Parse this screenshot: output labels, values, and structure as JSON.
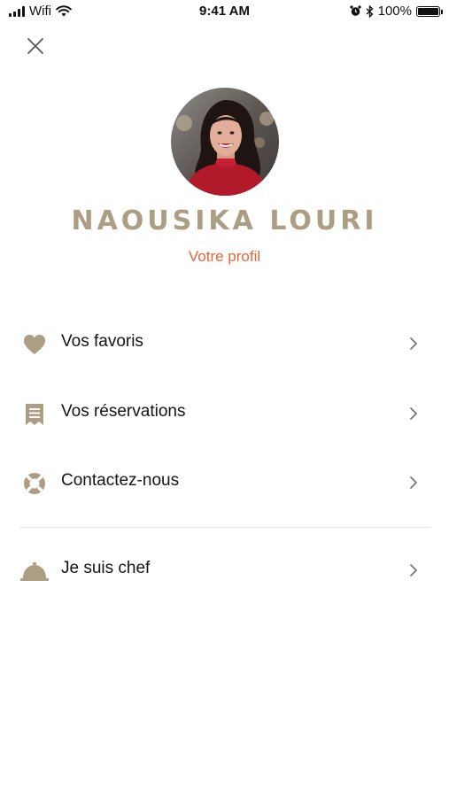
{
  "status_bar": {
    "carrier": "Wifi",
    "time": "9:41 AM",
    "battery_percent": "100%"
  },
  "profile": {
    "name": "NAOUSIKA LOURI",
    "profile_link": "Votre profil"
  },
  "menu": {
    "items": [
      {
        "label": "Vos favoris",
        "icon": "heart-icon"
      },
      {
        "label": "Vos réservations",
        "icon": "receipt-icon"
      },
      {
        "label": "Contactez-nous",
        "icon": "lifebuoy-icon"
      },
      {
        "label": "Je suis chef",
        "icon": "service-bell-icon"
      }
    ]
  },
  "colors": {
    "accent_gold": "#ab9e82",
    "link_orange": "#e5673a",
    "text_dark": "#141414",
    "divider": "#e3e3e3"
  }
}
